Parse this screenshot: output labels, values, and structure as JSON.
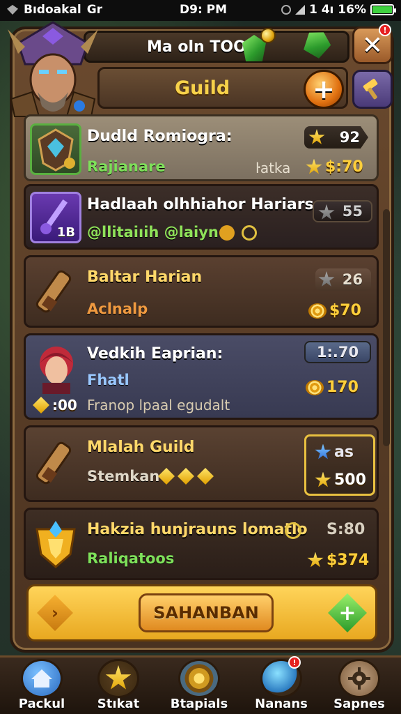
{
  "statusbar": {
    "left_text": "Bıdoakal",
    "carrier": "Gr",
    "time": "D9: PM",
    "right_text": "1 4ı 16%"
  },
  "topbar": {
    "title": "Ma oln TOO",
    "close_glyph": "✕"
  },
  "header": {
    "label": "Guild",
    "plus_glyph": "+"
  },
  "cards": [
    {
      "name": "Dudld Romiogra:",
      "sub": "Rajianare",
      "note": "ŀatka",
      "stars_badge": "92",
      "reward": "$:70",
      "sub_color": "#7ee05a",
      "icon": "shield-gem-icon"
    },
    {
      "name": "Hadlaah olhhiahor Hariars",
      "sub": "@llitaiıih @laiyn",
      "icon_level": "1B",
      "stars_badge": "55",
      "sub_color": "#8fe25a",
      "icon": "sword-icon"
    },
    {
      "name": "Baltar Harian",
      "sub": "Aclnalp",
      "stars_badge": "26",
      "reward": "$70",
      "sub_color": "#f09a40",
      "icon": "scroll-icon"
    },
    {
      "name": "Vedkih Eaprian:",
      "sub": "Fhatl",
      "note": "Franop lpaal egudalt",
      "timer": "1:.70",
      "reward": "170",
      "left_reward": ":00",
      "sub_color": "#9ac8ff",
      "icon": "warrior-portrait-icon"
    },
    {
      "name": "Mlalah Guild",
      "sub": "Stemkan",
      "blue_badge": "as",
      "reward": "500",
      "sub_color": "#e0d8c8",
      "icon": "scroll-icon"
    },
    {
      "name": "Hakzia hunjrauns lomatlo",
      "sub": "Raliqatoos",
      "value": "S:80",
      "reward": "$374",
      "sub_color": "#7ee05a",
      "icon": "gold-crest-icon"
    }
  ],
  "action": {
    "button_label": "SAHANBAN",
    "left_glyph": "›",
    "right_glyph": "+"
  },
  "nav": [
    {
      "label": "Packul",
      "icon": "home-icon",
      "color": "#3a8ae0"
    },
    {
      "label": "Stıkat",
      "icon": "star-icon",
      "color": "#e0b020"
    },
    {
      "label": "Btapials",
      "icon": "target-icon",
      "color": "#d09a20"
    },
    {
      "label": "Nanans",
      "icon": "orb-icon",
      "color": "#3a9ae0"
    },
    {
      "label": "Sapnes",
      "icon": "gear-icon",
      "color": "#9a7a5a"
    }
  ]
}
